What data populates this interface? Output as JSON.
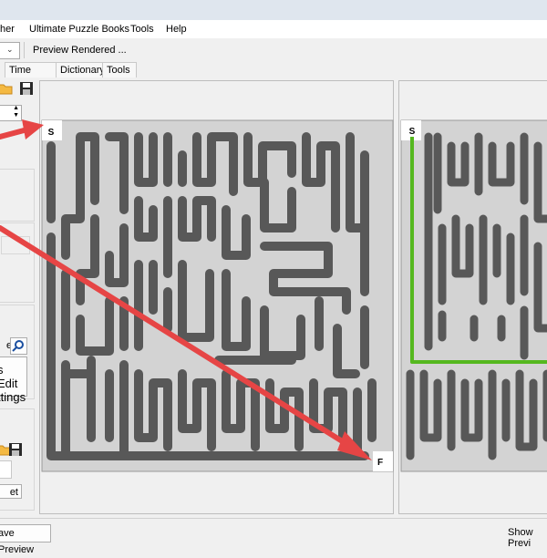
{
  "menu": {
    "items": [
      "her",
      "Ultimate Puzzle Books",
      "Tools",
      "Help"
    ]
  },
  "toolbar": {
    "preview_status": "Preview Rendered ..."
  },
  "tabs": [
    "Time Saver",
    "Dictionary",
    "Tools"
  ],
  "left_panel": {
    "edit_settings_line1": "s Edit",
    "edit_settings_line2": "ttings",
    "search_partial": "e",
    "reset_partial": "et"
  },
  "maze": {
    "start_label": "S",
    "finish_label": "F"
  },
  "solution_preview": {
    "start_label": "S"
  },
  "statusbar": {
    "save_preview": "ave Preview",
    "show_preview": "Show Previ"
  },
  "colors": {
    "arrow": "#e64545",
    "maze_wall": "#585858",
    "maze_bg": "#d3d3d3",
    "solution": "#55b81f"
  }
}
